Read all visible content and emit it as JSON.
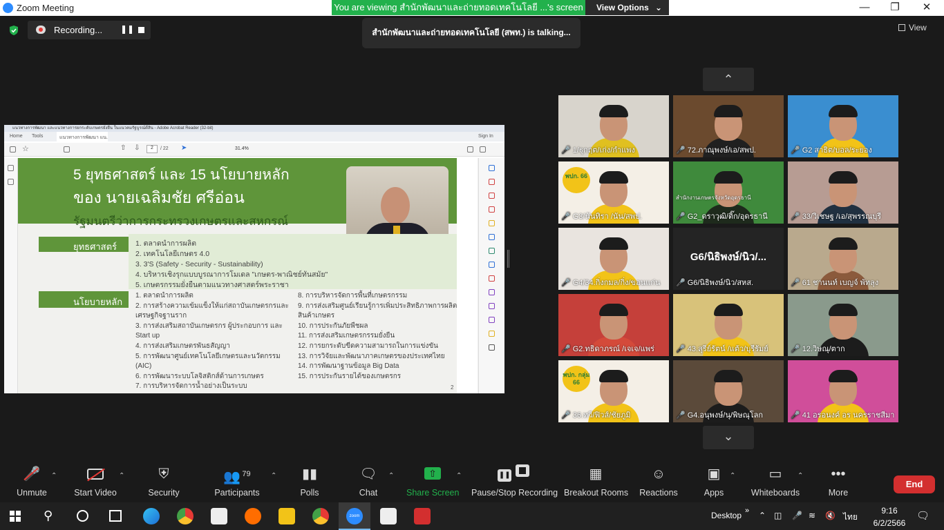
{
  "window": {
    "title": "Zoom Meeting"
  },
  "share_banner": {
    "text": "You are viewing สำนักพัฒนาและถ่ายทอดเทคโนโลยี ...'s screen",
    "options_label": "View Options"
  },
  "recording": {
    "label": "Recording..."
  },
  "talking": {
    "text": "สำนักพัฒนาและถ่ายทอดเทคโนโลยี (สพท.) is talking..."
  },
  "view_button": {
    "label": "View"
  },
  "pdf": {
    "titlebar": "แนวทางการพัฒนา และแนวทางการยกระดับเกษตรยั่งยืน ในแนวคมรัฐบูรณ์ดีสิน - Adobe Acrobat Reader (32-bit)",
    "menu_home": "Home",
    "menu_tools": "Tools",
    "doc_tab": "แนวทางการพัฒนา แน...",
    "sign_in": "Sign In",
    "page_current": "2",
    "page_total": "/ 22",
    "zoom": "31.4%",
    "slide_page_num": "2",
    "slide": {
      "title_line1": "5 ยุทธศาสตร์ และ 15 นโยบายหลัก",
      "title_line2": "ของ นายเฉลิมชัย ศรีอ่อน",
      "title_line3": "รัฐมนตรีว่าการกระทรวงเกษตรและสหกรณ์",
      "strategy_label": "ยุทธศาสตร์",
      "strategies": [
        "1. ตลาดนำการผลิต",
        "2. เทคโนโลยีเกษตร 4.0",
        "3. 3'S (Safety - Security - Sustainability)",
        "4. บริหารเชิงรุกแบบบูรณาการโมเดล \"เกษตร-พาณิชย์ทันสมัย\"",
        "5. เกษตรกรรมยั่งยืนตามแนวทางศาสตร์พระราชา"
      ],
      "policy_label": "นโยบายหลัก",
      "policies_left": [
        "1. ตลาดนำการผลิต",
        "2. การสร้างความเข้มแข็งให้แก่สถาบันเกษตรกรและ",
        "เศรษฐกิจฐานราก",
        "3. การส่งเสริมสถาบันเกษตรกร ผู้ประกอบการ และ",
        "Start up",
        "4. การส่งเสริมเกษตรพันธสัญญา",
        "5. การพัฒนาศูนย์เทคโนโลยีเกษตรและนวัตกรรม",
        "(AIC)",
        "6. การพัฒนาระบบโลจิสติกส์ด้านการเกษตร",
        "7. การบริหารจัดการน้ำอย่างเป็นระบบ"
      ],
      "policies_right": [
        "8. การบริหารจัดการพื้นที่เกษตรกรรม",
        "9. การส่งเสริมศูนย์เรียนรู้การเพิ่มประสิทธิภาพการผลิต",
        "สินค้าเกษตร",
        "10. การประกันภัยพืชผล",
        "11. การส่งเสริมเกษตรกรรมยั่งยืน",
        "12. การยกระดับขีดความสามารถในการแข่งขัน",
        "13. การวิจัยและพัฒนาภาคเกษตรของประเทศไทย",
        "14. การพัฒนาฐานข้อมูล Big Data",
        "15. การประกันรายได้ของเกษตรกร"
      ]
    }
  },
  "gallery": [
    {
      "name": "1/ฐุกฤต/เก่ง/กำแพง",
      "bg": "#d8d4cc",
      "shirt": "#e0c020"
    },
    {
      "name": "72.ภาณุพงษ์/เอ/สพป.",
      "bg": "#6b4a2e",
      "shirt": "#202020"
    },
    {
      "name": "G2 สาธิต/บอล/ระยอง",
      "bg": "#3a8ed0",
      "shirt": "#f2c318"
    },
    {
      "name": "G3/นันทิรา /นัน/สพป.",
      "bg": "#f4efe6",
      "shirt": "#f2c318",
      "logo": "พปก. 66"
    },
    {
      "name": "G2_ดราวุฒิ/ติ๊ก/อุดรธานี",
      "bg": "#3f8a3c",
      "shirt": "#1e2a1c",
      "caption": "สำนักงานเกษตรจังหวัดอุดรธานี"
    },
    {
      "name": "33/วิเชษฐ /เอ/สุพรรณบุรี",
      "bg": "#b79c93",
      "shirt": "#203040"
    },
    {
      "name": "G4/34.กิ่งกมล/กิ่ง/ขอนแก่น",
      "bg": "#e9e4df",
      "shirt": "#f2c318"
    },
    {
      "name": "G6/นิธิพงษ์/นิว/สหส.",
      "bg": "#242424",
      "shirt": "",
      "big_name": "G6/นิธิพงษ์/นิว/..."
    },
    {
      "name": "61 ชานนท์ เบญจ์ พัทลุง",
      "bg": "#b9a98d",
      "shirt": "#8b5a3c"
    },
    {
      "name": "G2.ทธิดาภรณ์ /เจเจ/แพร่",
      "bg": "#c5403a",
      "shirt": "#d44a3a"
    },
    {
      "name": "43.สุรีย์รัตน์ /แต้ว/บุรีรัมย์",
      "bg": "#d8c27a",
      "shirt": "#f2c318"
    },
    {
      "name": "12.วิษณุ/ตาก",
      "bg": "#8a9a8c",
      "shirt": "#1c1c1c"
    },
    {
      "name": "36.ทวี/ฟิวส์/ชัยภูมิ",
      "bg": "#f4efe6",
      "shirt": "#f2c318",
      "logo": "พปก. กลุ่ม 66"
    },
    {
      "name": "G4.อนุพงษ์/นุ/พิษณุโลก",
      "bg": "#5b4a3a",
      "shirt": "#1c1c1c"
    },
    {
      "name": "41 อรอนงค์ อร นครราชสีมา",
      "bg": "#d04e9a",
      "shirt": "#f2c318"
    }
  ],
  "toolbar": {
    "unmute": "Unmute",
    "start_video": "Start Video",
    "security": "Security",
    "participants": "Participants",
    "participants_count": "79",
    "polls": "Polls",
    "chat": "Chat",
    "share_screen": "Share Screen",
    "pause_recording": "Pause/Stop Recording",
    "breakout": "Breakout Rooms",
    "reactions": "Reactions",
    "apps": "Apps",
    "whiteboards": "Whiteboards",
    "more": "More",
    "end": "End"
  },
  "taskbar": {
    "desktop": "Desktop",
    "lang": "ไทย",
    "time": "9:16",
    "date": "6/2/2566"
  },
  "colors": {
    "green": "#22b14c",
    "end_red": "#d32f2f",
    "zoom_blue": "#2d8cff"
  }
}
